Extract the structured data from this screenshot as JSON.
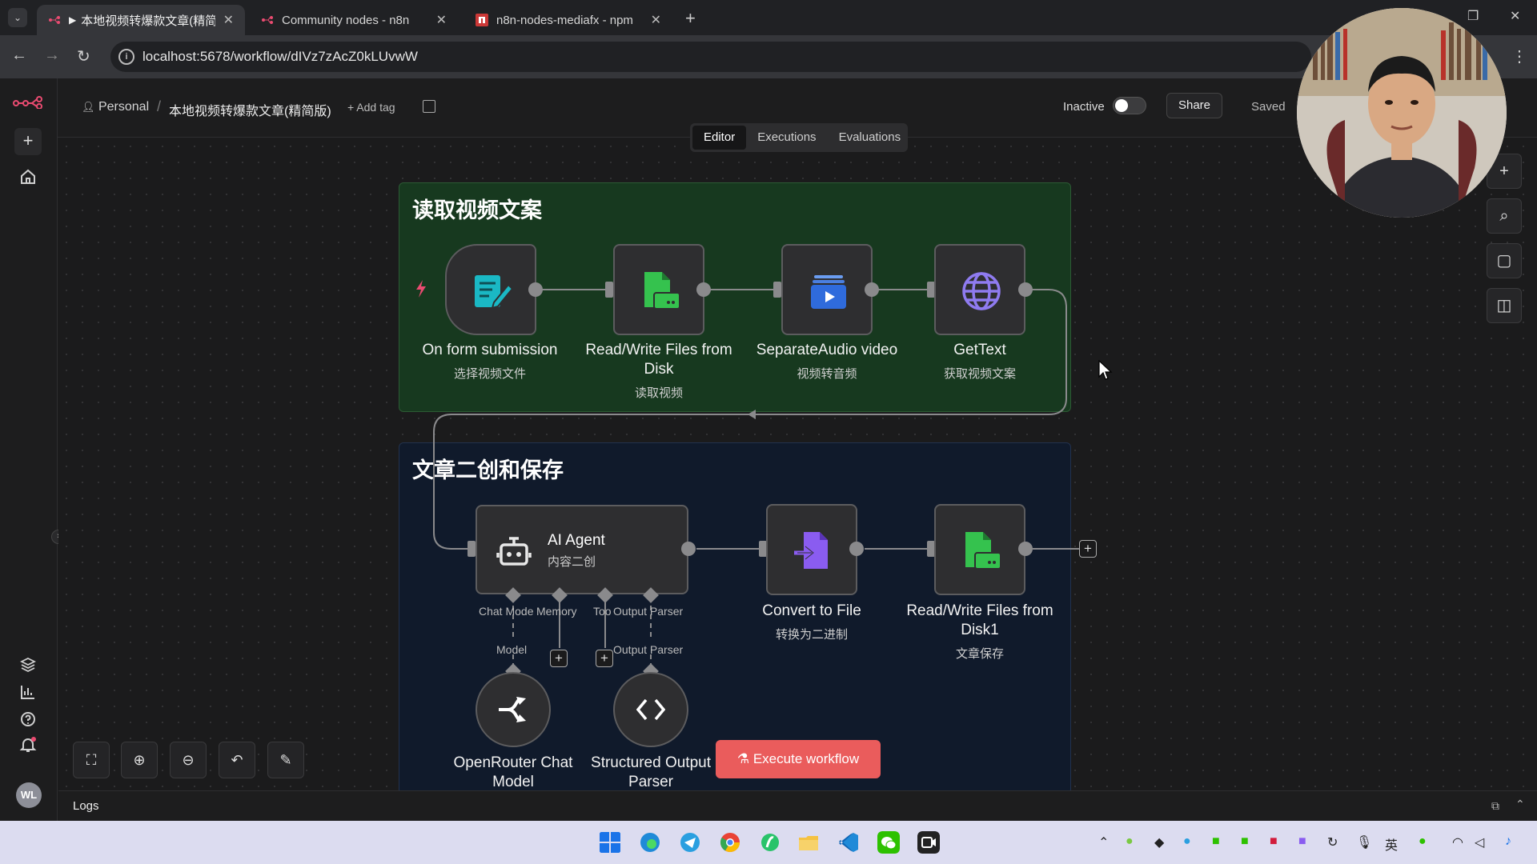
{
  "browser": {
    "tabs": [
      {
        "title": "本地视频转爆款文章(精简版",
        "active": true,
        "favicon": "n8n-icon"
      },
      {
        "title": "Community nodes - n8n",
        "active": false,
        "favicon": "n8n-icon"
      },
      {
        "title": "n8n-nodes-mediafx - npm",
        "active": false,
        "favicon": "npm-icon"
      }
    ],
    "url": "localhost:5678/workflow/dIVz7zAcZ0kLUvwW"
  },
  "header": {
    "breadcrumb_user": "Personal",
    "workflow_name": "本地视频转爆款文章(精简版)",
    "add_tag": "+ Add tag",
    "status_label": "Inactive",
    "share": "Share",
    "saved": "Saved",
    "tabs": [
      "Editor",
      "Executions",
      "Evaluations"
    ],
    "active_tab": "Editor"
  },
  "stickies": [
    {
      "title": "读取视频文案",
      "color": "#17391f"
    },
    {
      "title": "文章二创和保存",
      "color": "#101a2b"
    }
  ],
  "nodes": {
    "form": {
      "label": "On form submission",
      "sub": "选择视频文件",
      "icon": "form-icon"
    },
    "readfile": {
      "label": "Read/Write Files from",
      "label2": "Disk",
      "sub": "读取视频",
      "icon": "file-icon"
    },
    "separate": {
      "label": "SeparateAudio video",
      "sub": "视频转音频",
      "icon": "video-icon"
    },
    "gettext": {
      "label": "GetText",
      "sub": "获取视频文案",
      "icon": "globe-icon"
    },
    "agent": {
      "label": "AI Agent",
      "sub": "内容二创",
      "icon": "robot-icon"
    },
    "convert": {
      "label": "Convert to File",
      "sub": "转换为二进制",
      "icon": "convert-icon"
    },
    "savefile": {
      "label": "Read/Write Files from",
      "label2": "Disk1",
      "sub": "文章保存",
      "icon": "file-icon"
    },
    "openrouter": {
      "label": "OpenRouter Chat",
      "label2": "Model",
      "icon": "openrouter-icon"
    },
    "parser": {
      "label": "Structured Output",
      "label2": "Parser",
      "icon": "code-icon"
    }
  },
  "agent_ports": {
    "chat_model": "Chat Mode",
    "memory": "Memory",
    "tool": "Too",
    "output_parser": "Output Parser",
    "model_label": "Model",
    "output_parser_label": "Output Parser"
  },
  "execute_button": "Execute workflow",
  "logs": "Logs",
  "avatar_initials": "WL",
  "taskbar_tray": {
    "ime": "英"
  },
  "colors": {
    "accent": "#ea5c5c",
    "port": "#8a8a8c"
  }
}
